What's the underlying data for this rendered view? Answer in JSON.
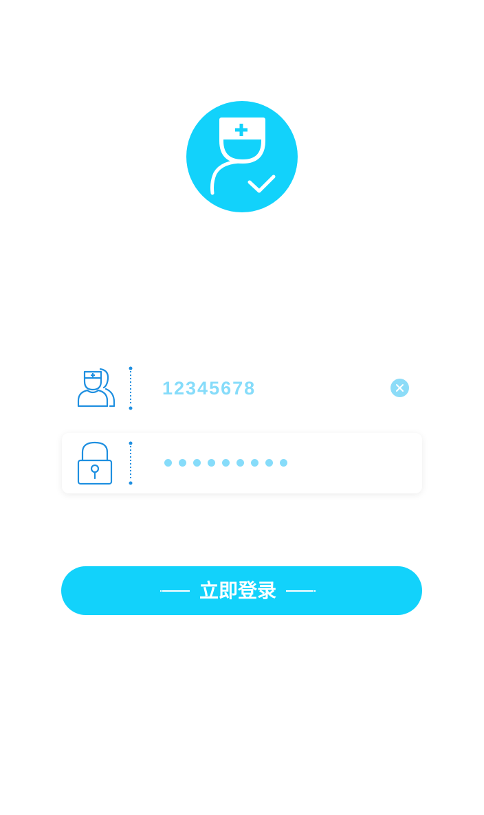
{
  "login": {
    "username_value": "12345678",
    "password_mask_count": 9,
    "button_label": "立即登录"
  },
  "icons": {
    "logo": "doctor-check-icon",
    "username": "doctors-icon",
    "password": "lock-icon",
    "clear": "close-icon"
  },
  "colors": {
    "accent": "#12d2fb",
    "icon_blue": "#1e8fe0",
    "placeholder": "#86dcfa",
    "background": "#ffffff"
  }
}
